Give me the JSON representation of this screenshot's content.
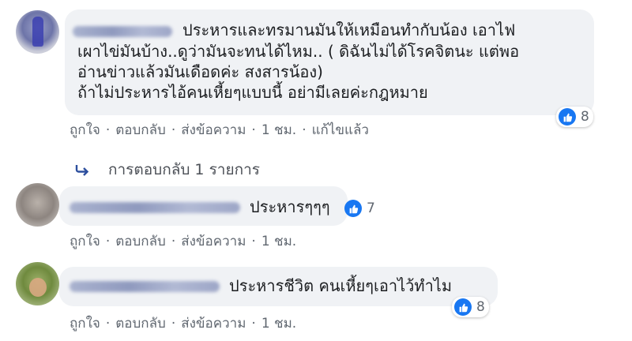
{
  "comments": [
    {
      "text_lines": [
        "ประหารและทรมานมันให้เหมือนทำกับน้อง เอาไฟ",
        "เผาไข่มันบ้าง..ดูว่ามันจะทนได้ไหม.. ( ดิฉันไม่ได้โรคจิตนะ แต่พอ",
        "อ่านข่าวแล้วมันเดือดค่ะ สงสารน้อง)",
        "ถ้าไม่ประหารไอ้คนเหี้ยๆแบบนี้ อย่ามีเลยค่ะกฎหมาย"
      ],
      "reaction_count": "8",
      "actions": {
        "like": "ถูกใจ",
        "reply": "ตอบกลับ",
        "message": "ส่งข้อความ",
        "time": "1 ชม.",
        "edited": "แก้ไขแล้ว"
      },
      "replies_label": "การตอบกลับ 1 รายการ"
    },
    {
      "text": "ประหารๆๆๆ",
      "reaction_count": "7",
      "actions": {
        "like": "ถูกใจ",
        "reply": "ตอบกลับ",
        "message": "ส่งข้อความ",
        "time": "1 ชม."
      }
    },
    {
      "text": "ประหารชีวิต คนเหี้ยๆเอาไว้ทำไม",
      "reaction_count": "8",
      "actions": {
        "like": "ถูกใจ",
        "reply": "ตอบกลับ",
        "message": "ส่งข้อความ",
        "time": "1 ชม."
      }
    }
  ],
  "separator": "·",
  "colors": {
    "like_blue": "#1877f2",
    "bubble": "#f0f2f5",
    "meta": "#606770"
  }
}
